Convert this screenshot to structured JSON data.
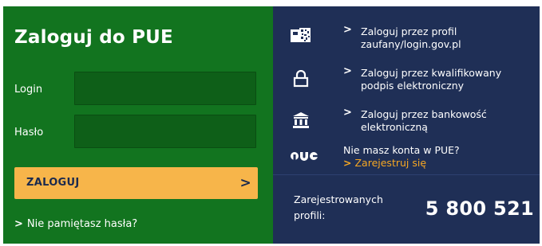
{
  "login_panel": {
    "title": "Zaloguj do PUE",
    "login_label": "Login",
    "password_label": "Hasło",
    "login_value": "",
    "password_value": "",
    "submit_label": "ZALOGUJ",
    "submit_chevron": ">",
    "forgot_chevron": ">",
    "forgot_label": "Nie pamiętasz hasła?"
  },
  "alt_login": {
    "options": [
      {
        "icon": "profil-zaufany-icon",
        "chevron": ">",
        "line1": "Zaloguj przez profil",
        "line2": "zaufany/login.gov.pl"
      },
      {
        "icon": "padlock-icon",
        "chevron": ">",
        "line1": "Zaloguj przez kwalifikowany",
        "line2": "podpis elektroniczny"
      },
      {
        "icon": "bank-icon",
        "chevron": ">",
        "line1": "Zaloguj przez bankowość",
        "line2": "elektroniczną"
      }
    ],
    "no_account": {
      "icon": "pue-logo-icon",
      "text": "Nie masz konta w PUE?",
      "link_chevron": ">",
      "link_label": "Zarejestruj się"
    },
    "registered": {
      "label_line1": "Zarejestrowanych",
      "label_line2": "profili:",
      "count": "5 800 521"
    }
  },
  "colors": {
    "green_panel": "#12741f",
    "navy_panel": "#1f2f56",
    "button": "#f7b54a",
    "link": "#f6a723"
  }
}
